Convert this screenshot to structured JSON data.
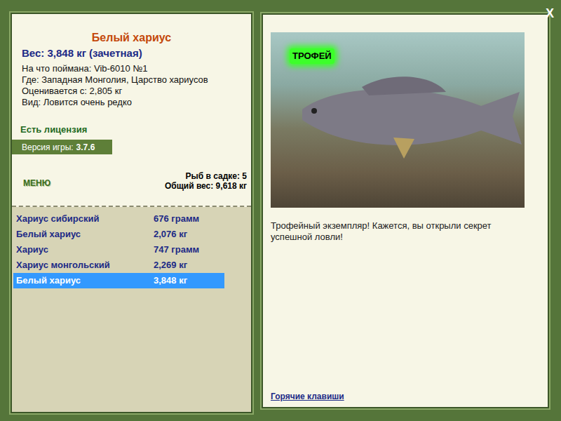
{
  "window": {
    "close": "X"
  },
  "fish": {
    "name": "Белый хариус",
    "weight": "Вес: 3,848 кг (зачетная)",
    "details": [
      "На что поймана: Vib-6010 №1",
      "Где: Западная Монголия, Царство хариусов",
      "Оценивается с: 2,805 кг",
      "Вид: Ловится очень редко"
    ],
    "license": "Есть лицензия",
    "version_label": "Версия игры:",
    "version": "3.7.6"
  },
  "menu": "МЕНЮ",
  "keepnet": {
    "count": "Рыб в садке: 5",
    "total": "Общий вес: 9,618 кг"
  },
  "catch_list": [
    {
      "name": "Хариус сибирский",
      "weight": "676 грамм",
      "selected": false
    },
    {
      "name": "Белый хариус",
      "weight": "2,076 кг",
      "selected": false
    },
    {
      "name": "Хариус",
      "weight": "747 грамм",
      "selected": false
    },
    {
      "name": "Хариус монгольский",
      "weight": "2,269 кг",
      "selected": false
    },
    {
      "name": "Белый хариус",
      "weight": "3,848 кг",
      "selected": true
    }
  ],
  "photo": {
    "badge": "ТРОФЕЙ"
  },
  "message": "Трофейный экземпляр! Кажется, вы открыли секрет успешной ловли!",
  "hotkeys_link": "Горячие клавиши"
}
